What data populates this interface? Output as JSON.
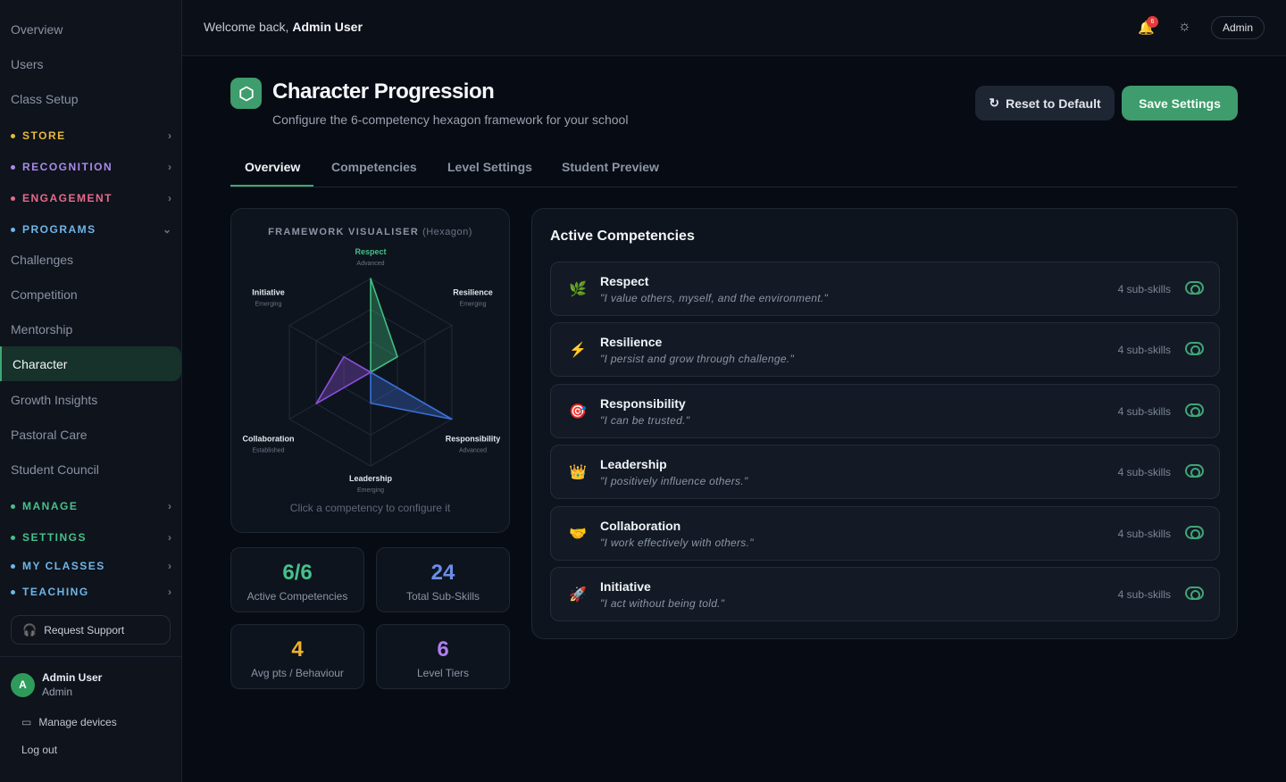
{
  "sidebar": {
    "items_top": [
      "Overview",
      "Users",
      "Class Setup"
    ],
    "groups": [
      {
        "label": "STORE",
        "color": "#e8b93a"
      },
      {
        "label": "RECOGNITION",
        "color": "#a98be8"
      },
      {
        "label": "ENGAGEMENT",
        "color": "#e86a8a"
      },
      {
        "label": "PROGRAMS",
        "color": "#6fb6e8"
      }
    ],
    "program_items": [
      "Challenges",
      "Competition",
      "Mentorship",
      "Character",
      "Growth Insights",
      "Pastoral Care",
      "Student Council"
    ],
    "active_item": "Character",
    "groups_bottom": [
      {
        "label": "MANAGE",
        "color": "#46c08a"
      },
      {
        "label": "SETTINGS",
        "color": "#46c08a"
      },
      {
        "label": "MY CLASSES",
        "color": "#6fb6e8"
      },
      {
        "label": "TEACHING",
        "color": "#6fb6e8"
      }
    ],
    "support_label": "Request Support",
    "user": {
      "initial": "A",
      "name": "Admin User",
      "role": "Admin"
    },
    "manage_devices": "Manage devices",
    "logout": "Log out"
  },
  "header": {
    "welcome_prefix": "Welcome back,",
    "welcome_name": "Admin User",
    "notification_count": "6",
    "role_chip": "Admin"
  },
  "page": {
    "title": "Character Progression",
    "subtitle": "Configure the 6-competency hexagon framework for your school",
    "reset_label": "Reset to Default",
    "save_label": "Save Settings"
  },
  "tabs": [
    "Overview",
    "Competencies",
    "Level Settings",
    "Student Preview"
  ],
  "visualiser": {
    "title": "FRAMEWORK VISUALISER",
    "title_suffix": "(Hexagon)",
    "hint": "Click a competency to configure it",
    "axes": [
      {
        "name": "Respect",
        "level": "Advanced",
        "value": 1.0,
        "color": "#3fbf7f"
      },
      {
        "name": "Resilience",
        "level": "Emerging",
        "value": 0.33,
        "color": "#3fbf7f"
      },
      {
        "name": "Responsibility",
        "level": "Advanced",
        "value": 1.0,
        "color": "#3b6fd8"
      },
      {
        "name": "Leadership",
        "level": "Emerging",
        "value": 0.33,
        "color": "#3b6fd8"
      },
      {
        "name": "Collaboration",
        "level": "Established",
        "value": 0.67,
        "color": "#8a4fd8"
      },
      {
        "name": "Initiative",
        "level": "Emerging",
        "value": 0.33,
        "color": "#8a4fd8"
      }
    ]
  },
  "stats": [
    {
      "value": "6/6",
      "label": "Active Competencies",
      "color": "#46c08a"
    },
    {
      "value": "24",
      "label": "Total Sub-Skills",
      "color": "#6b8fe8"
    },
    {
      "value": "4",
      "label": "Avg pts / Behaviour",
      "color": "#f0b429"
    },
    {
      "value": "6",
      "label": "Level Tiers",
      "color": "#b07ef0"
    }
  ],
  "competencies": {
    "heading": "Active Competencies",
    "rows": [
      {
        "icon": "🌿",
        "name": "Respect",
        "quote": "\"I value others, myself, and the environment.\"",
        "subs": "4 sub-skills"
      },
      {
        "icon": "⚡",
        "name": "Resilience",
        "quote": "\"I persist and grow through challenge.\"",
        "subs": "4 sub-skills"
      },
      {
        "icon": "🎯",
        "name": "Responsibility",
        "quote": "\"I can be trusted.\"",
        "subs": "4 sub-skills"
      },
      {
        "icon": "👑",
        "name": "Leadership",
        "quote": "\"I positively influence others.\"",
        "subs": "4 sub-skills"
      },
      {
        "icon": "🤝",
        "name": "Collaboration",
        "quote": "\"I work effectively with others.\"",
        "subs": "4 sub-skills"
      },
      {
        "icon": "🚀",
        "name": "Initiative",
        "quote": "\"I act without being told.\"",
        "subs": "4 sub-skills"
      }
    ]
  }
}
